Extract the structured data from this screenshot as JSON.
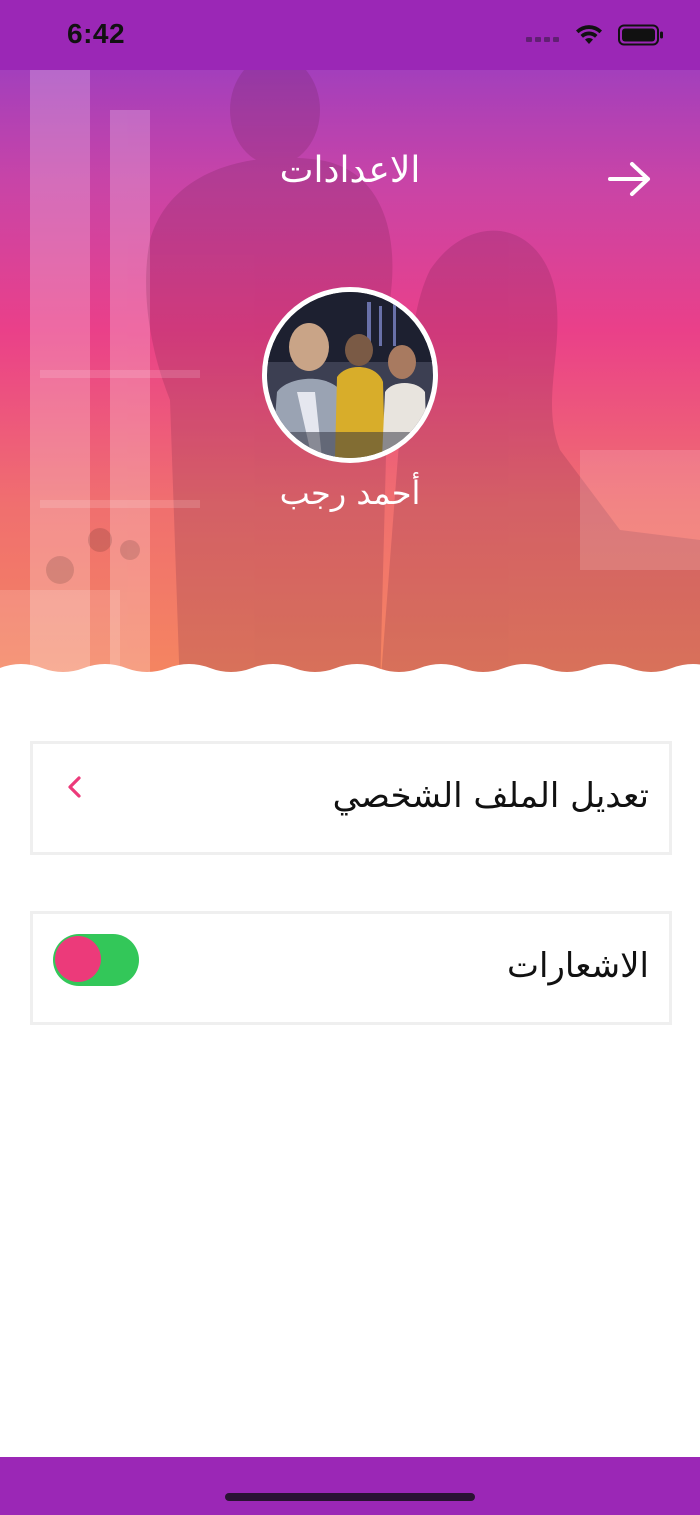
{
  "status_bar": {
    "time": "6:42",
    "signal_icon": "cellular-signal-icon",
    "wifi_icon": "wifi-icon",
    "battery_icon": "battery-icon"
  },
  "header": {
    "title": "الاعدادات",
    "back_icon": "arrow-right-icon"
  },
  "profile": {
    "name": "أحمد رجب",
    "avatar_icon": "avatar-photo"
  },
  "settings": {
    "edit_profile": {
      "label": "تعديل الملف الشخصي",
      "icon": "chevron-left-icon"
    },
    "notifications": {
      "label": "الاشعارات",
      "enabled": true
    }
  },
  "colors": {
    "status_bar": "#9b27b6",
    "gradient_top": "#a33fbc",
    "gradient_mid": "#ea4089",
    "gradient_bottom": "#f5875f",
    "accent_pink": "#ec3a7a",
    "toggle_on": "#33c759",
    "bottom_bar": "#9b27b6"
  }
}
